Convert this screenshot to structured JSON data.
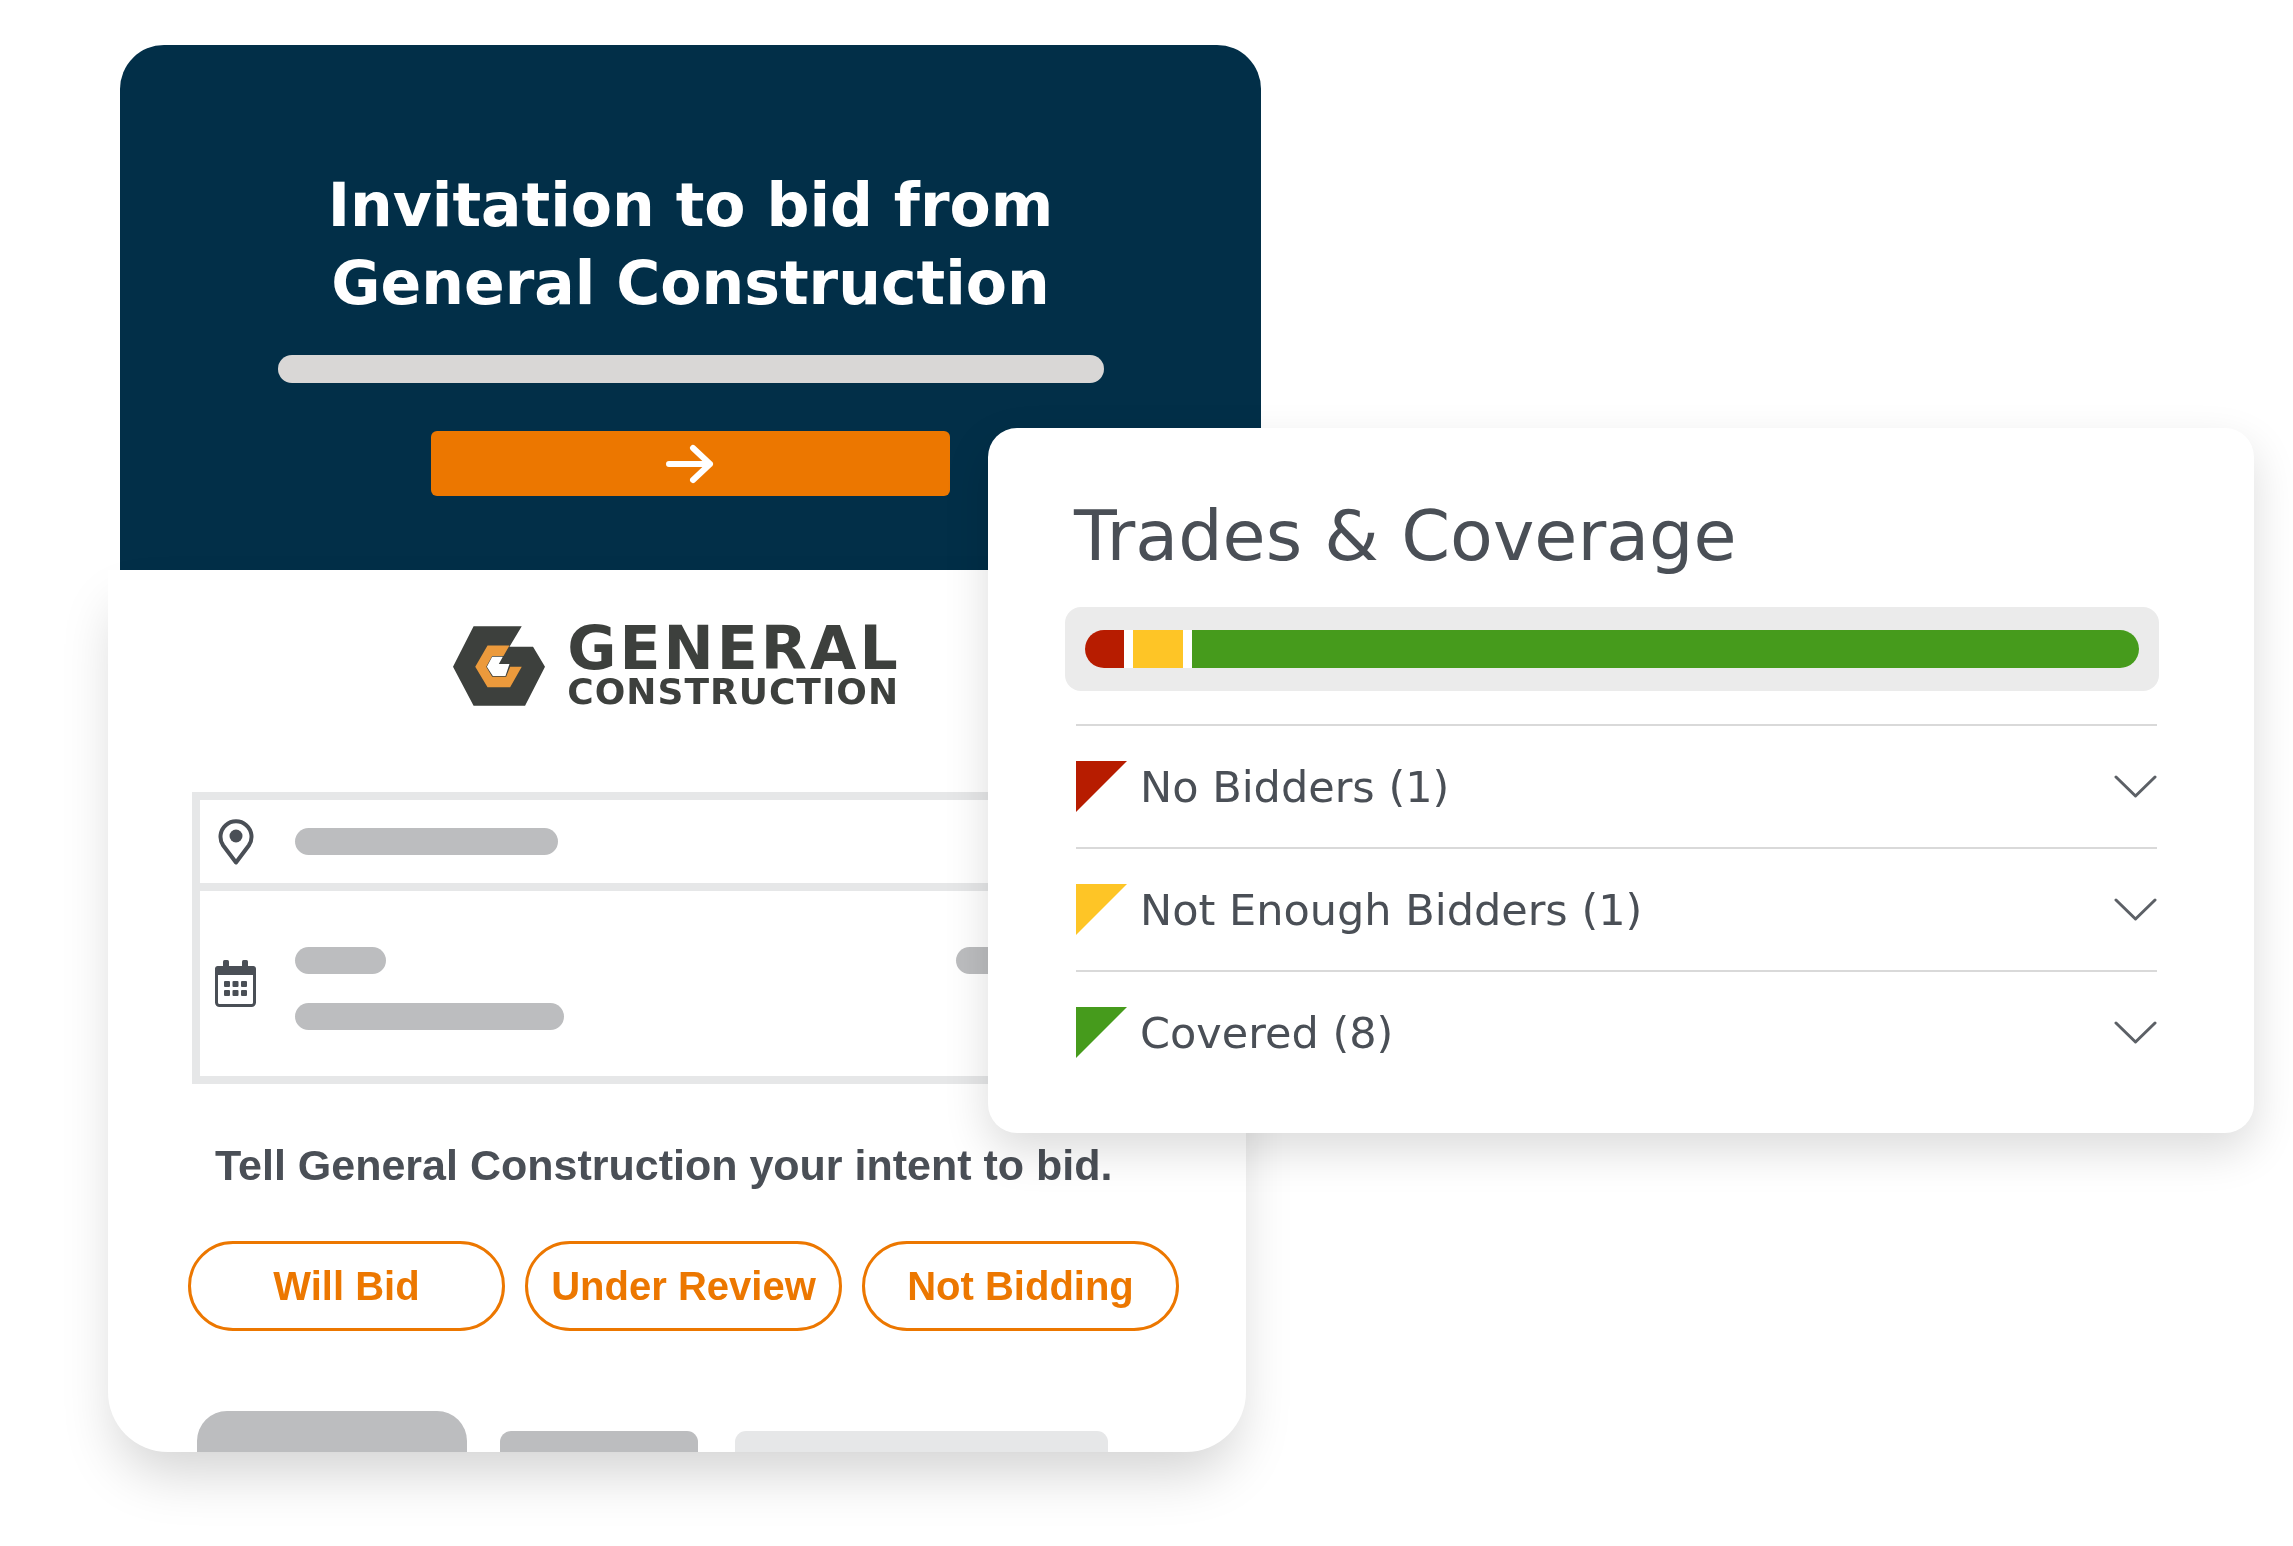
{
  "invitation_card": {
    "heading": "Invitation to bid from General Construction",
    "logo": {
      "line_1": "GENERAL",
      "line_2": "CONSTRUCTION"
    },
    "intent_prompt": "Tell General Construction your intent to bid.",
    "intent_buttons": [
      {
        "label": "Will Bid",
        "selected": false
      },
      {
        "label": "Under Review",
        "selected": false
      },
      {
        "label": "Not Bidding",
        "selected": false
      }
    ]
  },
  "coverage_card": {
    "title": "Trades & Coverage",
    "coverage_bar": {
      "segments": [
        {
          "color": "#b71c00",
          "level": 0.038
        },
        {
          "color": "#fec526",
          "level": 0.048
        },
        {
          "color": "#469b1c",
          "level": 0.914
        }
      ]
    },
    "groups": [
      {
        "label": "No Bidders (1)",
        "color": "#b71c00",
        "expanded": false
      },
      {
        "label": "Not Enough Bidders (1)",
        "color": "#fec526",
        "expanded": false
      },
      {
        "label": "Covered (8)",
        "color": "#469b1c",
        "expanded": false
      }
    ]
  }
}
